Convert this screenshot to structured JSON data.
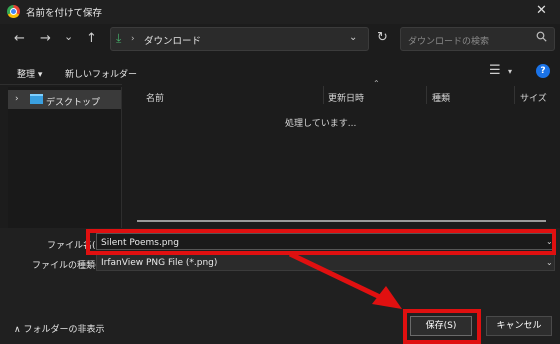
{
  "window": {
    "title": "名前を付けて保存",
    "close": "✕"
  },
  "nav": {
    "back": "←",
    "forward": "→",
    "recent": "⌄",
    "up": "↑",
    "address": "ダウンロード",
    "address_sep": "›",
    "address_chevron": "⌄",
    "refresh": "↻",
    "search_placeholder": "ダウンロードの検索"
  },
  "toolbar": {
    "organize": "整理 ▾",
    "new_folder": "新しいフォルダー"
  },
  "sidebar": {
    "items": [
      {
        "label": "デスクトップ"
      }
    ]
  },
  "file_list": {
    "columns": [
      "名前",
      "更新日時",
      "種類",
      "サイズ"
    ],
    "status": "処理しています..."
  },
  "form": {
    "filename_label": "ファイル名(N):",
    "filename_value": "Silent Poems.png",
    "filetype_label": "ファイルの種類(T):",
    "filetype_value": "IrfanView PNG File (*.png)"
  },
  "footer": {
    "hide_folders": "フォルダーの非表示",
    "save": "保存(S)",
    "cancel": "キャンセル"
  },
  "colors": {
    "annotation": "#e01010",
    "accent": "#1a73e8",
    "download_icon": "#46b06b"
  }
}
